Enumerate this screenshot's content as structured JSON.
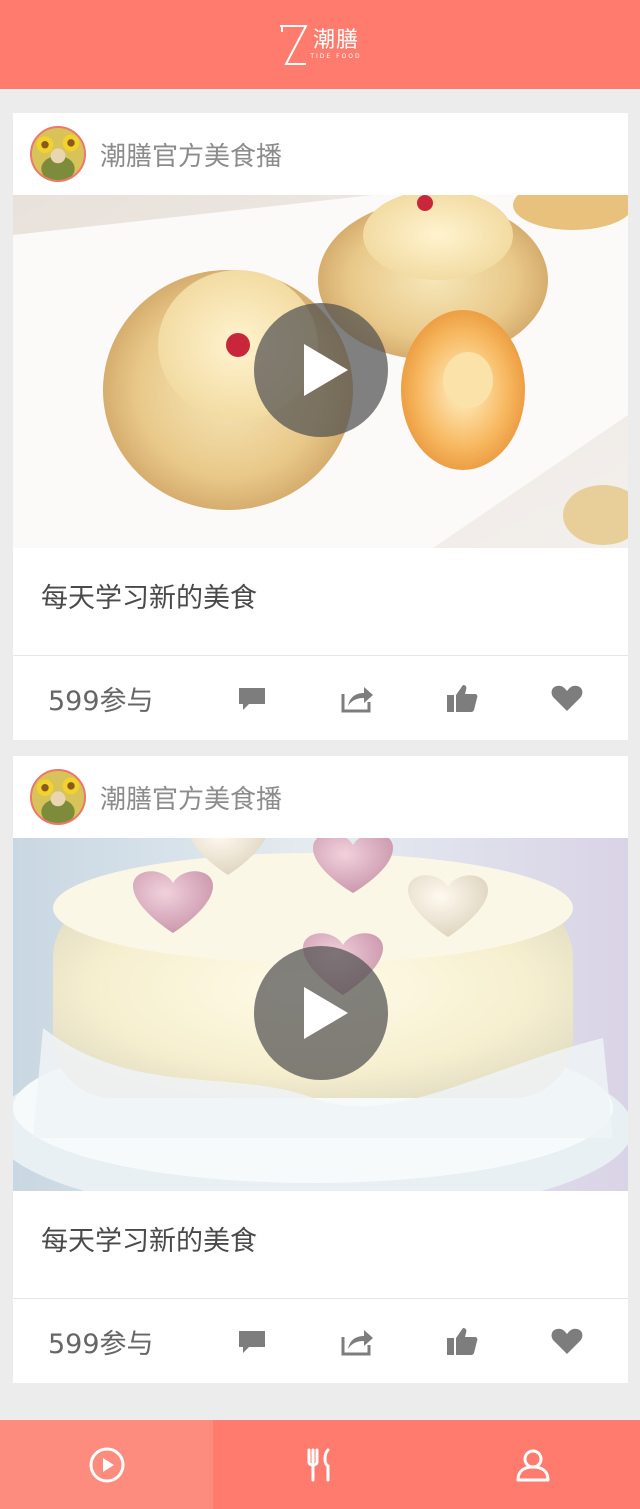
{
  "header": {
    "logo_cn": "潮膳",
    "logo_en": "TIDE FOOD"
  },
  "posts": [
    {
      "author": "潮膳官方美食播",
      "caption": "每天学习新的美食",
      "participants": "599参与",
      "image": "rose-tart-dessert"
    },
    {
      "author": "潮膳官方美食播",
      "caption": "每天学习新的美食",
      "participants": "599参与",
      "image": "white-heart-cake"
    }
  ],
  "icons": {
    "comment": "comment-icon",
    "share": "share-icon",
    "like": "thumbs-up-icon",
    "favorite": "heart-icon"
  },
  "bottom_nav": [
    {
      "icon": "play-circle-icon",
      "active": true
    },
    {
      "icon": "fork-knife-icon",
      "active": false
    },
    {
      "icon": "user-icon",
      "active": false
    }
  ],
  "colors": {
    "brand": "#fe7b6d",
    "icon_gray": "#7d7d7d"
  }
}
